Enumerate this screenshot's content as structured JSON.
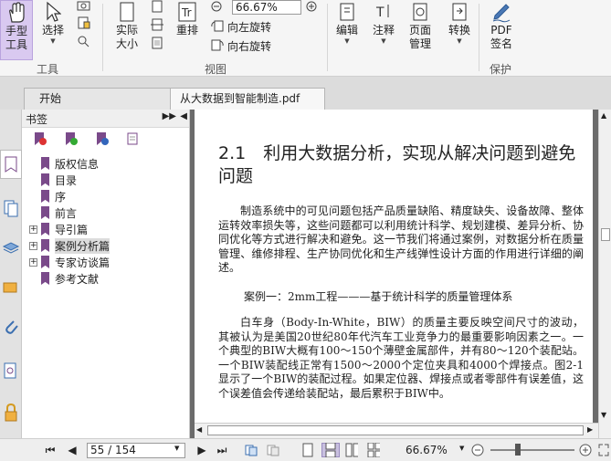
{
  "ribbon": {
    "hand_label": "手型\n工具",
    "select_label": "选择",
    "actual_size_label": "实际\n大小",
    "reflow_label": "重排",
    "zoom_value": "66.67%",
    "rotate_left": "向左旋转",
    "rotate_right": "向右旋转",
    "edit_label": "编辑",
    "comment_label": "注释",
    "page_mgmt_label": "页面\n管理",
    "convert_label": "转换",
    "pdf_sign_label": "PDF\n签名",
    "groups": {
      "tools": "工具",
      "view": "视图",
      "protect": "保护"
    }
  },
  "tabs": [
    {
      "label": "开始"
    },
    {
      "label": "从大数据到智能制造.pdf"
    }
  ],
  "bookmarks": {
    "title": "书签",
    "items": [
      {
        "label": "版权信息",
        "expandable": false
      },
      {
        "label": "目录",
        "expandable": false
      },
      {
        "label": "序",
        "expandable": false
      },
      {
        "label": "前言",
        "expandable": false
      },
      {
        "label": "导引篇",
        "expandable": true
      },
      {
        "label": "案例分析篇",
        "expandable": true,
        "selected": true
      },
      {
        "label": "专家访谈篇",
        "expandable": true
      },
      {
        "label": "参考文献",
        "expandable": false
      }
    ]
  },
  "document": {
    "heading": "2.1　利用大数据分析，实现从解决问题到避免问题",
    "para1": "制造系统中的可见问题包括产品质量缺陷、精度缺失、设备故障、整体运转效率损失等，这些问题都可以利用统计科学、规划建模、差异分析、协同优化等方式进行解决和避免。这一节我们将通过案例，对数据分析在质量管理、维修排程、生产协同优化和生产线弹性设计方面的作用进行详细的阐述。",
    "case_title": "案例一：2mm工程———基于统计科学的质量管理体系",
    "para2": "白车身（Body-In-White，BIW）的质量主要反映空间尺寸的波动，其被认为是美国20世纪80年代汽车工业竞争力的最重要影响因素之一。一个典型的BIW大概有100～150个薄壁金属部件，并有80～120个装配站。一个BIW装配线正常有1500～2000个定位夹具和4000个焊接点。图2-1显示了一个BIW的装配过程。如果定位器、焊接点或者零部件有误差值，这个误差值会传递给装配站，最后累积于BIW中。"
  },
  "status": {
    "page_display": "55 / 154",
    "zoom": "66.67%"
  },
  "colors": {
    "accent": "#7a4a8a",
    "hand_bg": "#d9c9f0"
  }
}
